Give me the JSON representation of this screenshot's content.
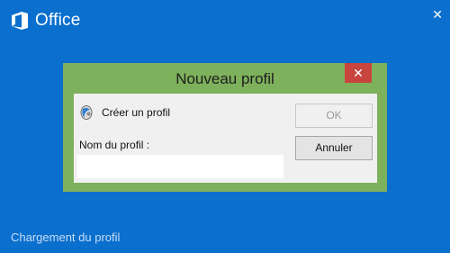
{
  "app": {
    "brand_name": "Office",
    "close_glyph": "✕"
  },
  "dialog": {
    "title": "Nouveau profil",
    "close_glyph": "✕",
    "create_label": "Créer un profil",
    "name_label": "Nom du profil :",
    "name_value": "",
    "ok_label": "OK",
    "cancel_label": "Annuler"
  },
  "status": {
    "text": "Chargement du profil"
  },
  "icons": {
    "brand": "office-logo-icon",
    "profile": "profile-icon"
  },
  "colors": {
    "background": "#0b6fce",
    "dialog_frame": "#7eb15c",
    "close_button": "#c7453d",
    "panel": "#f0f0f0"
  }
}
